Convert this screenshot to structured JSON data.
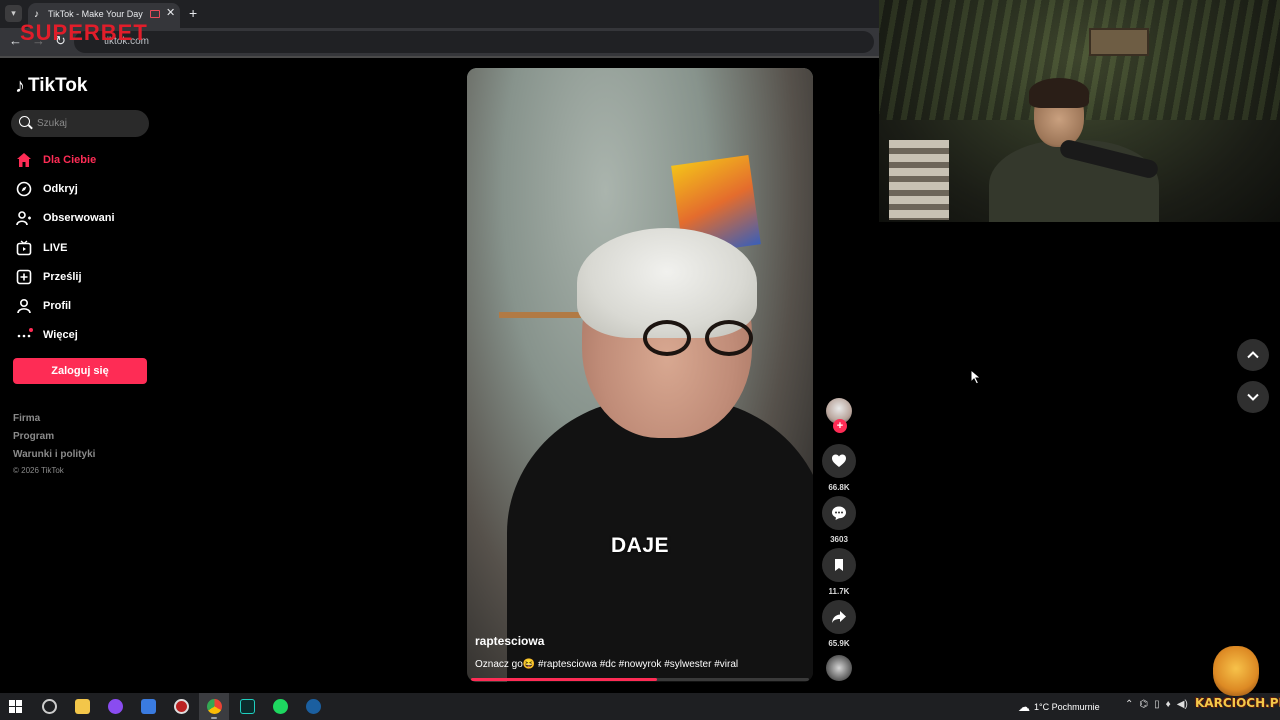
{
  "browser": {
    "tab_title": "TikTok - Make Your Day",
    "url": "tiktok.com",
    "overlay_logo": "SUPERBET",
    "new_tab_label": "+",
    "tab_close_label": "✕"
  },
  "sidebar": {
    "logo_text": "TikTok",
    "search_placeholder": "Szukaj",
    "nav": [
      {
        "label": "Dla Ciebie",
        "icon": "home-icon",
        "active": true
      },
      {
        "label": "Odkryj",
        "icon": "compass-icon"
      },
      {
        "label": "Obserwowani",
        "icon": "following-icon"
      },
      {
        "label": "LIVE",
        "icon": "live-icon"
      },
      {
        "label": "Prześlij",
        "icon": "upload-icon"
      },
      {
        "label": "Profil",
        "icon": "profile-icon"
      },
      {
        "label": "Więcej",
        "icon": "more-icon"
      }
    ],
    "login_label": "Zaloguj się",
    "footer_links": [
      "Firma",
      "Program",
      "Warunki i polityki"
    ],
    "copyright": "© 2026 TikTok"
  },
  "video": {
    "caption_overlay": "DAJE",
    "author": "raptesciowa",
    "description": "Oznacz go😆 #raptesciowa #dc #nowyrok #sylwester #viral",
    "progress": 0.55
  },
  "actions": {
    "follow_label": "+",
    "likes": "66.8K",
    "comments": "3603",
    "bookmarks": "11.7K",
    "shares": "65.9K"
  },
  "taskbar": {
    "weather": "1°C  Pochmurnie"
  },
  "overlay_brand": "KARCIOCH.PL",
  "colors": {
    "accent": "#fe2c55",
    "background": "#000000"
  }
}
